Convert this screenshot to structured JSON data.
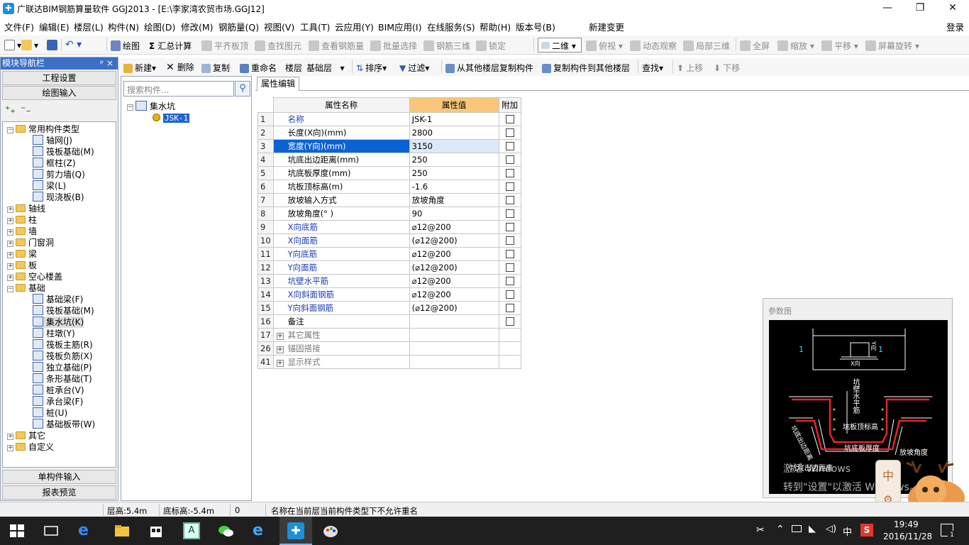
{
  "window": {
    "title": "广联达BIM钢筋算量软件 GGJ2013 - [E:\\李家湾农贸市场.GGJ12]",
    "minimize": "—",
    "maximize": "❐",
    "close": "✕"
  },
  "menubar": {
    "items": [
      "文件(F)",
      "编辑(E)",
      "楼层(L)",
      "构件(N)",
      "绘图(D)",
      "修改(M)",
      "钢筋量(Q)",
      "视图(V)",
      "工具(T)",
      "云应用(Y)",
      "BIM应用(I)",
      "在线服务(S)",
      "帮助(H)",
      "版本号(B)"
    ],
    "new_change": "新建变更",
    "login": "登录"
  },
  "toolbar1": {
    "draw": "绘图",
    "sum_calc": "汇总计算",
    "flat_top": "平齐板顶",
    "find_element": "查找图元",
    "view_rebar": "查看钢筋量",
    "batch_select": "批量选择",
    "rebar_3d": "钢筋三维",
    "lock": "锁定",
    "view_mode": "二维",
    "top_view": "俯视",
    "dynamic_view": "动态观察",
    "local_3d": "局部三维",
    "fullscreen": "全屏",
    "zoom": "缩放",
    "pan": "平移",
    "screen_rotate": "屏幕旋转"
  },
  "toolbar2": {
    "new": "新建",
    "delete": "删除",
    "copy": "复制",
    "rename": "重命名",
    "floor_label": "楼层",
    "floor_value": "基础层",
    "sort": "排序",
    "filter": "过滤",
    "copy_from_floor": "从其他楼层复制构件",
    "copy_to_floor": "复制构件到其他楼层",
    "find": "查找",
    "move_up": "上移",
    "move_down": "下移"
  },
  "nav": {
    "header": "模块导航栏",
    "pin": "ᵖ ×",
    "project_settings": "工程设置",
    "drawing_input": "绘图输入",
    "single_input": "单构件输入",
    "report_preview": "报表预览",
    "tree": {
      "common": "常用构件类型",
      "common_children": [
        "轴网(J)",
        "筏板基础(M)",
        "框柱(Z)",
        "剪力墙(Q)",
        "梁(L)",
        "现浇板(B)"
      ],
      "groups1": [
        "轴线",
        "柱",
        "墙",
        "门窗洞",
        "梁",
        "板",
        "空心楼盖"
      ],
      "foundation": "基础",
      "foundation_children": [
        "基础梁(F)",
        "筏板基础(M)",
        "集水坑(K)",
        "柱墩(Y)",
        "筏板主筋(R)",
        "筏板负筋(X)",
        "独立基础(P)",
        "条形基础(T)",
        "桩承台(V)",
        "承台梁(F)",
        "桩(U)",
        "基础板带(W)"
      ],
      "groups2": [
        "其它",
        "自定义"
      ]
    }
  },
  "component_list": {
    "search_placeholder": "搜索构件...",
    "group": "集水坑",
    "item": "JSK-1"
  },
  "properties": {
    "tab": "属性编辑",
    "col_name": "属性名称",
    "col_value": "属性值",
    "col_extra": "附加",
    "rows": [
      {
        "num": "1",
        "name": "名称",
        "value": "JSK-1",
        "blue": true
      },
      {
        "num": "2",
        "name": "长度(X向)(mm)",
        "value": "2800",
        "blue": false
      },
      {
        "num": "3",
        "name": "宽度(Y向)(mm)",
        "value": "3150",
        "blue": false
      },
      {
        "num": "4",
        "name": "坑底出边距离(mm)",
        "value": "250",
        "blue": false
      },
      {
        "num": "5",
        "name": "坑底板厚度(mm)",
        "value": "250",
        "blue": false
      },
      {
        "num": "6",
        "name": "坑板顶标高(m)",
        "value": "-1.6",
        "blue": false
      },
      {
        "num": "7",
        "name": "放坡输入方式",
        "value": "放坡角度",
        "blue": false
      },
      {
        "num": "8",
        "name": "放坡角度(° )",
        "value": "90",
        "blue": false
      },
      {
        "num": "9",
        "name": "X向底筋",
        "value": "⌀12@200",
        "blue": true
      },
      {
        "num": "10",
        "name": "X向面筋",
        "value": "(⌀12@200)",
        "blue": true
      },
      {
        "num": "11",
        "name": "Y向底筋",
        "value": "⌀12@200",
        "blue": true
      },
      {
        "num": "12",
        "name": "Y向面筋",
        "value": "(⌀12@200)",
        "blue": true
      },
      {
        "num": "13",
        "name": "坑壁水平筋",
        "value": "⌀12@200",
        "blue": true
      },
      {
        "num": "14",
        "name": "X向斜面钢筋",
        "value": "⌀12@200",
        "blue": true
      },
      {
        "num": "15",
        "name": "Y向斜面钢筋",
        "value": "(⌀12@200)",
        "blue": true
      },
      {
        "num": "16",
        "name": "备注",
        "value": "",
        "blue": false
      }
    ],
    "groups": [
      {
        "num": "17",
        "name": "其它属性"
      },
      {
        "num": "26",
        "name": "锚固搭接"
      },
      {
        "num": "41",
        "name": "显示样式"
      }
    ]
  },
  "param_diagram": {
    "title": "参数图",
    "labels": {
      "x_dir": "X向",
      "y_dir": "Y向",
      "num": "1",
      "wall_horizontal": "坑壁水平筋",
      "top_elev": "坑板顶标高",
      "bottom_thick": "坑底板厚度",
      "slope_angle": "放坡角度",
      "bottom_edge": "坑底出边距离",
      "bottom_edge2": "坑底出边距离"
    }
  },
  "watermark": {
    "line1": "激活 Windows",
    "line2": "转到\"设置\"以激活 Windows。"
  },
  "statusbar": {
    "floor_height": "层高:5.4m",
    "base_elev": "底标高:-5.4m",
    "zero": "0",
    "message": "名称在当前层当前构件类型下不允许重名"
  },
  "taskbar": {
    "time": "19:49",
    "date": "2016/11/28",
    "ime": "中",
    "notify_count": "1"
  },
  "ime_badge": "中"
}
